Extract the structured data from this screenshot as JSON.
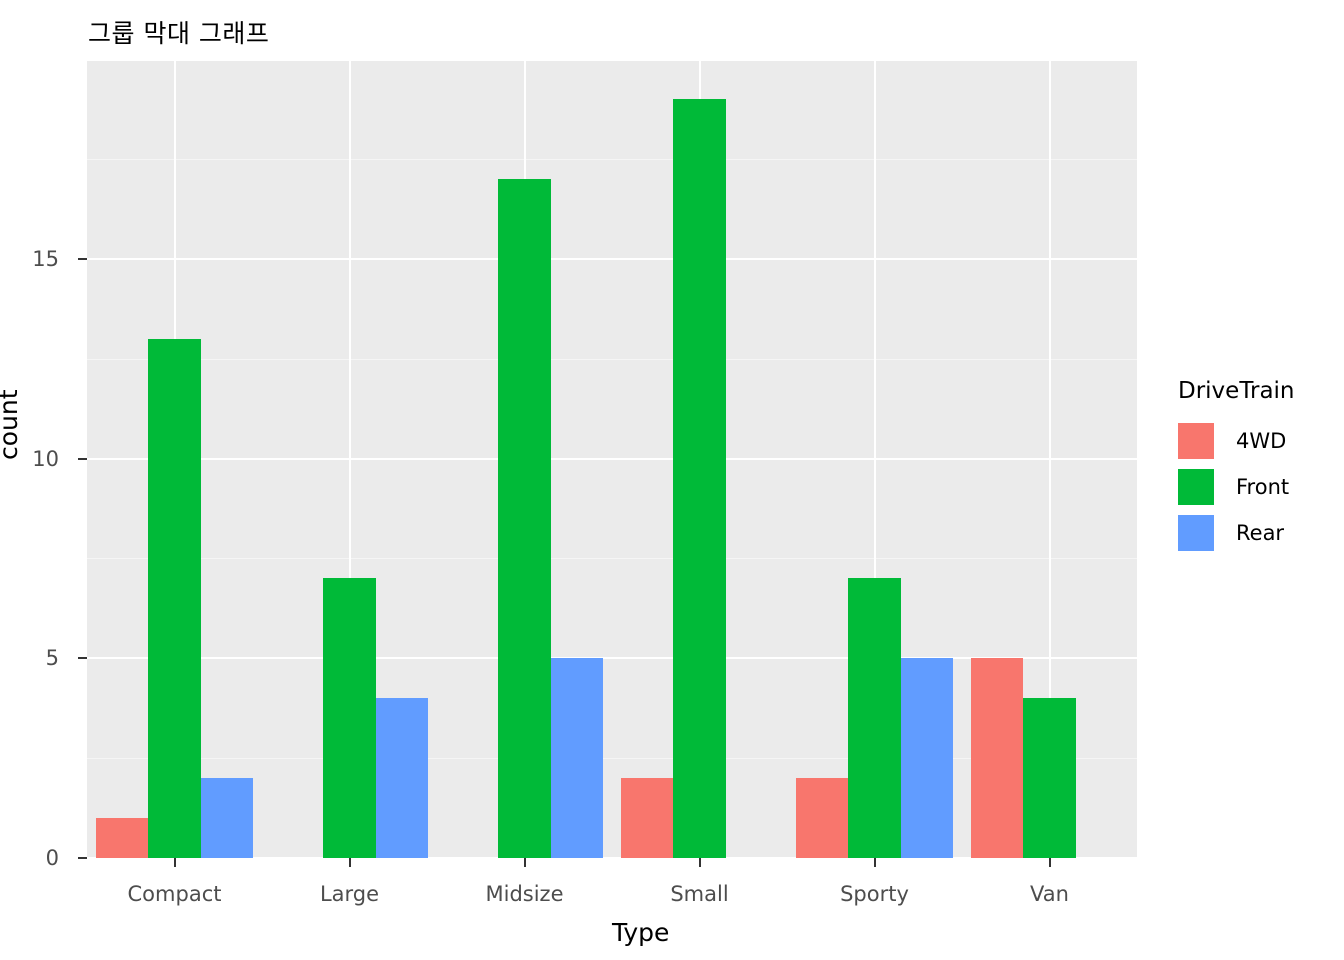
{
  "chart_data": {
    "type": "bar",
    "title": "그룹 막대 그래프",
    "xlabel": "Type",
    "ylabel": "count",
    "categories": [
      "Compact",
      "Large",
      "Midsize",
      "Small",
      "Sporty",
      "Van"
    ],
    "series": [
      {
        "name": "4WD",
        "color": "#F8766D",
        "values": [
          1,
          0,
          0,
          2,
          2,
          5
        ]
      },
      {
        "name": "Front",
        "color": "#00BA38",
        "values": [
          13,
          7,
          17,
          19,
          7,
          4
        ]
      },
      {
        "name": "Rear",
        "color": "#619CFF",
        "values": [
          2,
          4,
          5,
          0,
          5,
          0
        ]
      }
    ],
    "ylim": [
      0,
      19.95
    ],
    "yticks": [
      0,
      5,
      10,
      15
    ],
    "ytick_labels": [
      "0",
      "5",
      "10",
      "15"
    ],
    "yminor": [
      2.5,
      7.5,
      12.5,
      17.5
    ],
    "grid": true,
    "legend_position": "right",
    "legend_title": "DriveTrain",
    "panel_background": "#EBEBEB",
    "grid_color": "#FFFFFF",
    "plot_background": "#FFFFFF"
  }
}
